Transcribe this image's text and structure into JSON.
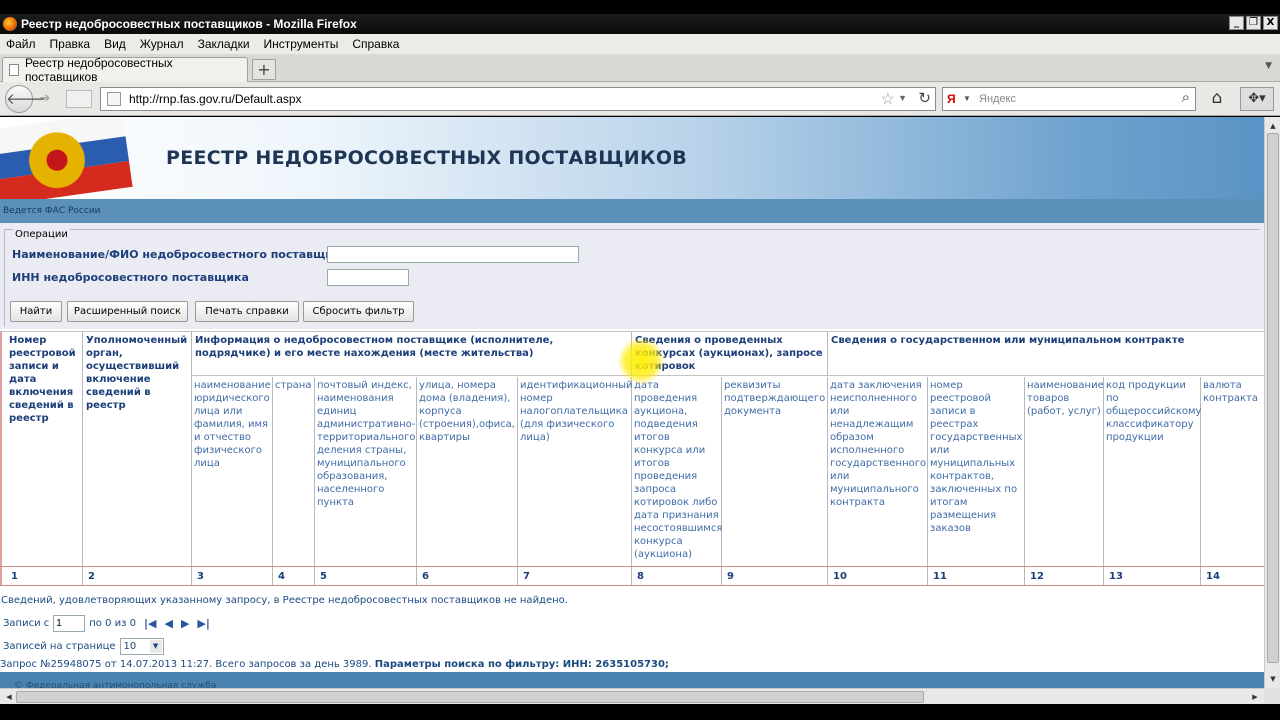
{
  "window": {
    "title": "Реестр недобросовестных поставщиков - Mozilla Firefox",
    "buttons": [
      "_",
      "❐",
      "X"
    ]
  },
  "menu": [
    "Файл",
    "Правка",
    "Вид",
    "Журнал",
    "Закладки",
    "Инструменты",
    "Справка"
  ],
  "tab": {
    "title": "Реестр недобросовестных поставщиков",
    "new_tab": "+"
  },
  "nav": {
    "url": "http://rnp.fas.gov.ru/Default.aspx",
    "search_placeholder": "Яндекс",
    "search_engine": "Я"
  },
  "page": {
    "header_title": "РЕЕСТР НЕДОБРОСОВЕСТНЫХ ПОСТАВЩИКОВ",
    "maintained_by": "Ведется ФАС России",
    "operations": {
      "legend": "Операции",
      "name_label": "Наименование/ФИО недобросовестного поставщика",
      "name_value": "",
      "inn_label": "ИНН недобросовестного поставщика",
      "inn_value": "",
      "buttons": {
        "find": "Найти",
        "advanced": "Расширенный поиск",
        "print": "Печать справки",
        "reset": "Сбросить фильтр"
      }
    },
    "table": {
      "col1": "Номер реестровой записи и дата включения сведений в реестр",
      "col2": "Уполномоченный орган, осуществивший включение сведений в реестр",
      "group_supplier": "Информация о недобросовестном поставщике (исполнителе, подрядчике) и его месте нахождения (месте жительства)",
      "group_auction": "Сведения о проведенных конкурсах (аукционах), запросе котировок",
      "group_contract": "Сведения о государственном или муниципальном контракте",
      "sub": [
        "наименование юридического лица или фамилия, имя и отчество физического лица",
        "страна",
        "почтовый индекс, наименования единиц административно-территориального деления страны, муниципального образования, населенного пункта",
        "улица, номера дома (владения), корпуса (строения),офиса, квартиры",
        "идентификационный номер налогоплательщика (для физического лица)",
        "дата проведения аукциона, подведения итогов конкурса или итогов проведения запроса котировок либо дата признания несостоявшимся конкурса (аукциона)",
        "реквизиты подтверждающего документа",
        "дата заключения неисполненного или ненадлежащим образом исполненного государственного или муниципального контракта",
        "номер реестровой записи в реестрах государственных или муниципальных контрактов, заключенных по итогам размещения заказов",
        "наименование товаров (работ, услуг)",
        "код продукции по общероссийскому классификатору продукции",
        "валюта контракта"
      ],
      "numbers": [
        "1",
        "2",
        "3",
        "4",
        "5",
        "6",
        "7",
        "8",
        "9",
        "10",
        "11",
        "12",
        "13",
        "14"
      ]
    },
    "not_found": "Сведений, удовлетворяющих указанному запросу, в Реестре недобросовестных поставщиков не найдено.",
    "pager": {
      "records_from": "Записи с",
      "from_value": "1",
      "range_text": "по 0 из 0",
      "nav": [
        "|◀",
        "◀",
        "▶",
        "▶|"
      ]
    },
    "per_page": {
      "label": "Записей на странице",
      "value": "10"
    },
    "request_info": "Запрос №25948075 от 14.07.2013 11:27. Всего запросов за день 3989.",
    "filter_params": "Параметры поиска по фильтру: ИНН: 2635105730;",
    "footer": "© Федеральная антимонопольная служба"
  }
}
